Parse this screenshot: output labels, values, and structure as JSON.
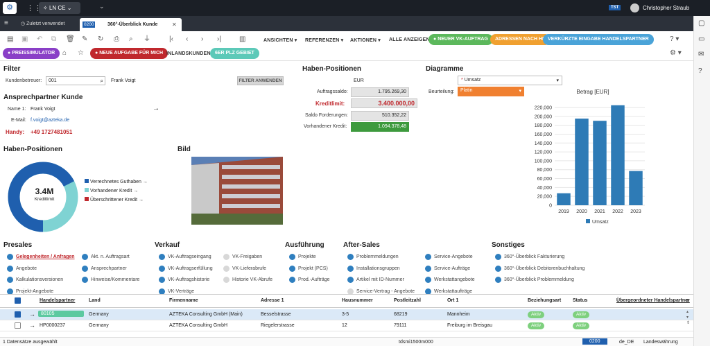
{
  "topbar": {
    "app_switch": "LN CE",
    "env": "TST",
    "user": "Christopher Straub"
  },
  "tabs": {
    "recent": "Zuletzt verwendet",
    "active_code": "0200",
    "active_label": "360°-Überblick Kunde"
  },
  "toolbar": {
    "ansichten": "ANSICHTEN",
    "referenzen": "REFERENZEN",
    "aktionen": "AKTIONEN",
    "alle": "ALLE ANZEIGEN",
    "btn_vk": "NEUER VK-AUFTRAG",
    "btn_adr": "ADRESSEN NACH HP",
    "btn_kurz": "VERKÜRZTE EINGABE HANDELSPARTNER",
    "btn_preis": "PREISSIMULATOR",
    "btn_aufgabe": "NEUE AUFGABE FÜR MICH",
    "inland": "INLANDSKUNDEN",
    "plz": "6ER PLZ GEBIET"
  },
  "filter": {
    "title": "Filter",
    "label": "Kundenbetreuer:",
    "value": "001",
    "name": "Frank Voigt",
    "apply": "FILTER ANWENDEN"
  },
  "contact": {
    "title": "Ansprechpartner Kunde",
    "name_label": "Name 1:",
    "name": "Frank Voigt",
    "email_label": "E-Mail:",
    "email": "f.voigt@azteka.de",
    "handy_label": "Handy:",
    "handy": "+49 1727481051"
  },
  "haben": {
    "title": "Haben-Positionen",
    "currency": "EUR",
    "auftragssaldo_label": "Auftragssaldo:",
    "auftragssaldo": "1.795.269,30",
    "kreditlimit_label": "Kreditlimit:",
    "kreditlimit": "3.400.000,00",
    "saldo_label": "Saldo Forderungen:",
    "saldo": "510.352,22",
    "vorhanden_label": "Vorhandener Kredit:",
    "vorhanden": "1.094.378,48"
  },
  "donut": {
    "title": "Haben-Positionen",
    "center_value": "3.4M",
    "center_label": "Kreditlimit",
    "legend": [
      "Verrechnetes Guthaben",
      "Vorhandener Kredit",
      "Überschrittener Kredit"
    ],
    "colors": [
      "#1f5fae",
      "#7fd3d3",
      "#c0282d"
    ]
  },
  "bild": {
    "title": "Bild"
  },
  "diagramme": {
    "title": "Diagramme",
    "select": "Umsatz",
    "beurteilung_label": "Beurteilung:",
    "beurteilung": "Platin"
  },
  "chart_data": {
    "type": "bar",
    "title": "Betrag [EUR]",
    "categories": [
      "2019",
      "2020",
      "2021",
      "2022",
      "2023"
    ],
    "series": [
      {
        "name": "Umsatz",
        "values": [
          27000,
          195000,
          190000,
          225000,
          77000
        ]
      }
    ],
    "ylim": [
      0,
      220000
    ],
    "yticks": [
      "0",
      "20,000",
      "40,000",
      "60,000",
      "80,000",
      "100,000",
      "120,000",
      "140,000",
      "160,000",
      "180,000",
      "200,000",
      "220,000"
    ],
    "color": "#2e7bb6",
    "legend": "bottom"
  },
  "sections": {
    "presales": {
      "title": "Presales",
      "col1": [
        "Gelegenheiten / Anfragen",
        "Angebote",
        "Kalkulationsversionen",
        "Projekt-Angebote"
      ],
      "col2": [
        "Akt. n. Auftragsart",
        "Ansprechpartner",
        "Hinweise/Kommentare"
      ]
    },
    "verkauf": {
      "title": "Verkauf",
      "col1": [
        "VK-Auftragseingang",
        "VK-Auftragserfüllung",
        "VK-Auftragshistorie",
        "VK-Verträge"
      ],
      "col2": [
        "VK-Freigaben",
        "VK-Lieferabrufe",
        "Historie VK-Abrufe"
      ]
    },
    "ausfuehrung": {
      "title": "Ausführung",
      "col1": [
        "Projekte",
        "Projekt (PCS)",
        "Prod.-Aufträge"
      ]
    },
    "aftersales": {
      "title": "After-Sales",
      "col1": [
        "Problemmeldungen",
        "Installationsgruppen",
        "Artikel mit ID-Nummer",
        "Service-Vertrag - Angebote"
      ],
      "col2": [
        "Service-Angebote",
        "Service-Aufträge",
        "Werkstattangebote",
        "Werkstattaufträge"
      ]
    },
    "sonstiges": {
      "title": "Sonstiges",
      "col1": [
        "360°-Überblick Fakturierung",
        "360°-Überblick Debitorenbuchhaltung",
        "360°-Überblick Problemmeldung"
      ]
    }
  },
  "table": {
    "headers": [
      "Handelspartner",
      "Land",
      "Firmenname",
      "Adresse 1",
      "Hausnummer",
      "Postleitzahl",
      "Ort 1",
      "Beziehungsart",
      "Status",
      "Übergeordneter Handelspartner"
    ],
    "rows": [
      [
        "80105",
        "Germany",
        "AZTEKA Consulting GmbH (Main)",
        "Besselstrasse",
        "3-5",
        "68219",
        "Mannheim",
        "Aktiv",
        "Aktiv"
      ],
      [
        "HP0000237",
        "Germany",
        "AZTEKA Consulting GmbH",
        "Riegelerstrasse",
        "12",
        "79111",
        "Freiburg im Breisgau",
        "Aktiv",
        "Aktiv"
      ]
    ]
  },
  "status": {
    "selected": "1 Datensätze ausgewählt",
    "session": "tdsmi1500m000",
    "company": "0200",
    "locale": "de_DE",
    "currency": "Landeswährung"
  }
}
